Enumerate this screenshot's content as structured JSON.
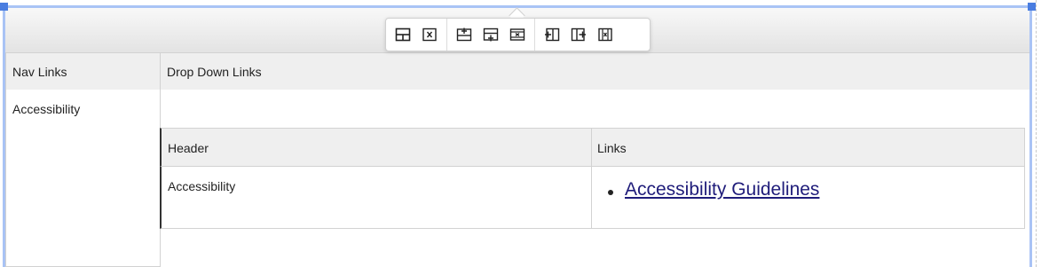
{
  "outer_table": {
    "headers": [
      "Nav Links",
      "Drop Down Links"
    ],
    "row": {
      "nav": "Accessibility"
    }
  },
  "inner_table": {
    "headers": [
      "Header",
      "Links"
    ],
    "row": {
      "header": "Accessibility",
      "links": [
        "Accessibility Guidelines"
      ]
    }
  },
  "toolbar": {
    "groups": [
      [
        "table-properties-icon",
        "delete-table-icon"
      ],
      [
        "insert-row-above-icon",
        "insert-row-below-icon",
        "delete-row-icon"
      ],
      [
        "insert-column-left-icon",
        "insert-column-right-icon",
        "delete-column-icon"
      ]
    ]
  },
  "colors": {
    "selection": "#a9c3f5",
    "handle": "#4a7de0",
    "link": "#1f1c7a",
    "header_bg": "#efefef"
  }
}
